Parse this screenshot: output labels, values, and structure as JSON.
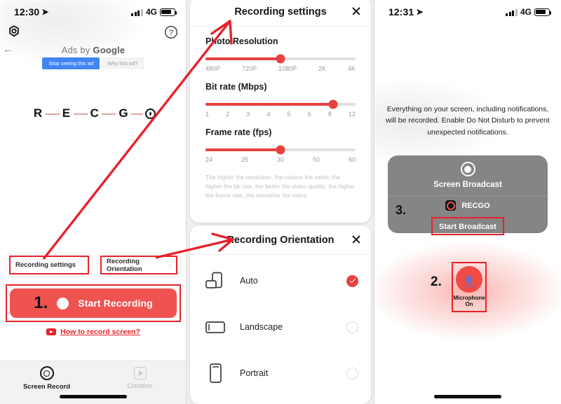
{
  "left_panel": {
    "status": {
      "time": "12:30",
      "network": "4G",
      "location_icon": "location-arrow-icon"
    },
    "ad": {
      "label": "Ads by ",
      "brand": "Google",
      "stop_button": "Stop seeing this ad",
      "why_button": "Why this ad?"
    },
    "logo": {
      "chars": [
        "R",
        "E",
        "C",
        "G"
      ],
      "dot_icon": "recgo-target-icon"
    },
    "options": [
      {
        "label": "Recording settings",
        "chevron": "chevron-right-icon"
      },
      {
        "label": "Recording Orientation",
        "chevron": "chevron-right-icon"
      }
    ],
    "start": {
      "step": "1.",
      "label": "Start Recording"
    },
    "howto": {
      "label": "How to record screen?",
      "icon": "youtube-icon"
    },
    "tabs": [
      {
        "label": "Screen Record",
        "icon": "record-circle-icon",
        "active": true
      },
      {
        "label": "Creation",
        "icon": "video-play-icon",
        "active": false
      }
    ]
  },
  "recording_settings": {
    "title": "Recording settings",
    "close_icon": "close-icon",
    "sliders": [
      {
        "label": "Photo Resolution",
        "ticks": [
          "480P",
          "720P",
          "1080P",
          "2K",
          "4K"
        ],
        "value": "1080P",
        "percent": 50
      },
      {
        "label": "Bit rate (Mbps)",
        "ticks": [
          "1",
          "2",
          "3",
          "4",
          "5",
          "6",
          "8",
          "12"
        ],
        "value": "8",
        "percent": 85
      },
      {
        "label": "Frame rate (fps)",
        "ticks": [
          "24",
          "25",
          "30",
          "50",
          "60"
        ],
        "value": "30",
        "percent": 50
      }
    ],
    "note": "The higher the resolution, the clearer the video; the higher the bit rate, the better the video quality; the higher the frame rate, the smoother the video."
  },
  "recording_orientation": {
    "title": "Recording Orientation",
    "close_icon": "close-icon",
    "options": [
      {
        "label": "Auto",
        "icon": "auto-rotate-icon",
        "selected": true
      },
      {
        "label": "Landscape",
        "icon": "landscape-phone-icon",
        "selected": false
      },
      {
        "label": "Portrait",
        "icon": "portrait-phone-icon",
        "selected": false
      }
    ]
  },
  "right_panel": {
    "status": {
      "time": "12:31",
      "network": "4G",
      "location_icon": "location-arrow-icon"
    },
    "notice": "Everything on your screen, including notifications, will be recorded. Enable Do Not Disturb to prevent unexpected notifications.",
    "broadcast": {
      "title": "Screen Broadcast",
      "app_name": "RECGO",
      "app_icon": "recgo-app-icon",
      "step": "3.",
      "start_label": "Start Broadcast"
    },
    "microphone": {
      "step": "2.",
      "icon": "microphone-icon",
      "label": "Microphone",
      "state": "On"
    }
  },
  "colors": {
    "accent_red": "#e8212a",
    "button_red": "#ef5350",
    "slider_red": "#e8403f",
    "gray_card": "#858585"
  }
}
